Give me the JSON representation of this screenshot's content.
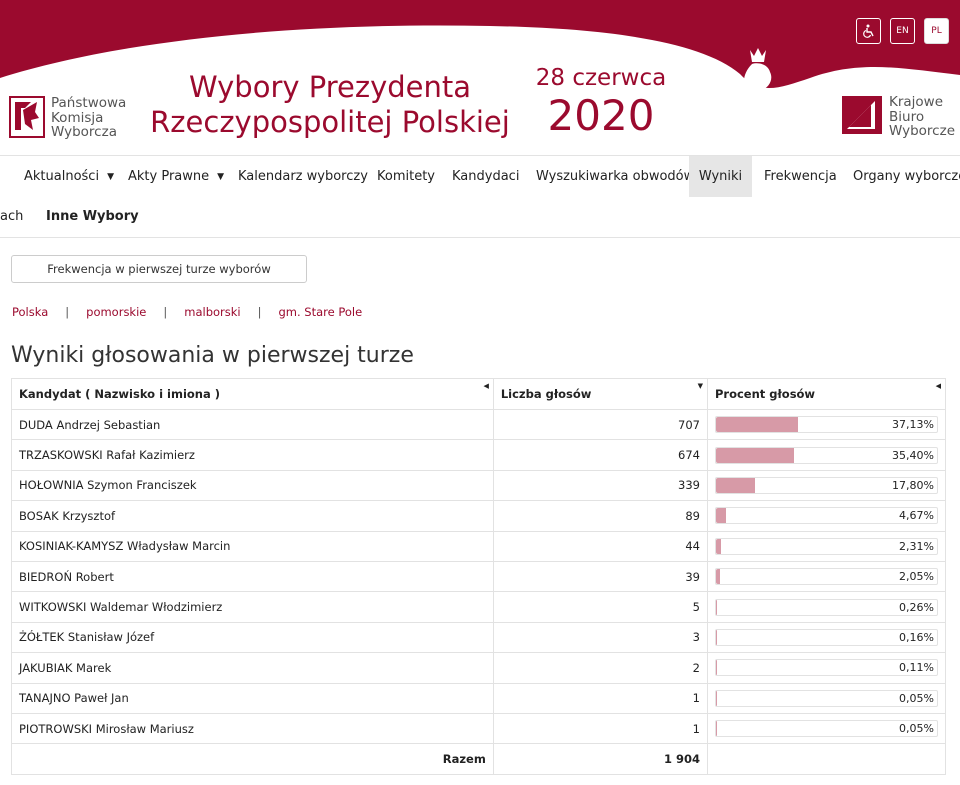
{
  "header": {
    "pkw_logo_lines": [
      "Państwowa",
      "Komisja",
      "Wyborcza"
    ],
    "title_line1": "Wybory Prezydenta",
    "title_line2": "Rzeczypospolitej Polskiej",
    "date_line1": "28 czerwca",
    "date_line2": "2020",
    "kbw_logo_lines": [
      "Krajowe",
      "Biuro",
      "Wyborcze"
    ],
    "accessibility_icon": "wheelchair-icon",
    "lang_en": "EN",
    "lang_pl": "PL",
    "brand_color": "#9b0a2e"
  },
  "nav": {
    "items": [
      {
        "label": "Aktualności",
        "dropdown": true
      },
      {
        "label": "Akty Prawne",
        "dropdown": true
      },
      {
        "label": "Kalendarz wyborczy"
      },
      {
        "label": "Komitety"
      },
      {
        "label": "Kandydaci"
      },
      {
        "label": "Wyszukiwarka obwodów"
      },
      {
        "label": "Wyniki",
        "active": true
      },
      {
        "label": "Frekwencja"
      },
      {
        "label": "Organy wyborcze"
      }
    ],
    "sub_items": [
      "ach",
      "Inne Wybory"
    ]
  },
  "turnout_button": "Frekwencja w pierwszej turze wyborów",
  "breadcrumb": [
    "Polska",
    "pomorskie",
    "malborski",
    "gm. Stare Pole"
  ],
  "results": {
    "title": "Wyniki głosowania w pierwszej turze",
    "headers": [
      "Kandydat ( Nazwisko i imiona )",
      "Liczba głosów",
      "Procent głosów"
    ],
    "rows": [
      {
        "name": "DUDA Andrzej Sebastian",
        "votes": "707",
        "percent": "37,13%",
        "pct_value": 37.13
      },
      {
        "name": "TRZASKOWSKI Rafał Kazimierz",
        "votes": "674",
        "percent": "35,40%",
        "pct_value": 35.4
      },
      {
        "name": "HOŁOWNIA Szymon Franciszek",
        "votes": "339",
        "percent": "17,80%",
        "pct_value": 17.8
      },
      {
        "name": "BOSAK Krzysztof",
        "votes": "89",
        "percent": "4,67%",
        "pct_value": 4.67
      },
      {
        "name": "KOSINIAK-KAMYSZ Władysław Marcin",
        "votes": "44",
        "percent": "2,31%",
        "pct_value": 2.31
      },
      {
        "name": "BIEDROŃ Robert",
        "votes": "39",
        "percent": "2,05%",
        "pct_value": 2.05
      },
      {
        "name": "WITKOWSKI Waldemar Włodzimierz",
        "votes": "5",
        "percent": "0,26%",
        "pct_value": 0.26
      },
      {
        "name": "ŻÓŁTEK Stanisław Józef",
        "votes": "3",
        "percent": "0,16%",
        "pct_value": 0.16
      },
      {
        "name": "JAKUBIAK Marek",
        "votes": "2",
        "percent": "0,11%",
        "pct_value": 0.11
      },
      {
        "name": "TANAJNO Paweł Jan",
        "votes": "1",
        "percent": "0,05%",
        "pct_value": 0.05
      },
      {
        "name": "PIOTROWSKI Mirosław Mariusz",
        "votes": "1",
        "percent": "0,05%",
        "pct_value": 0.05
      }
    ],
    "total_label": "Razem",
    "total_votes": "1 904",
    "bar_color": "#d79aa7"
  }
}
